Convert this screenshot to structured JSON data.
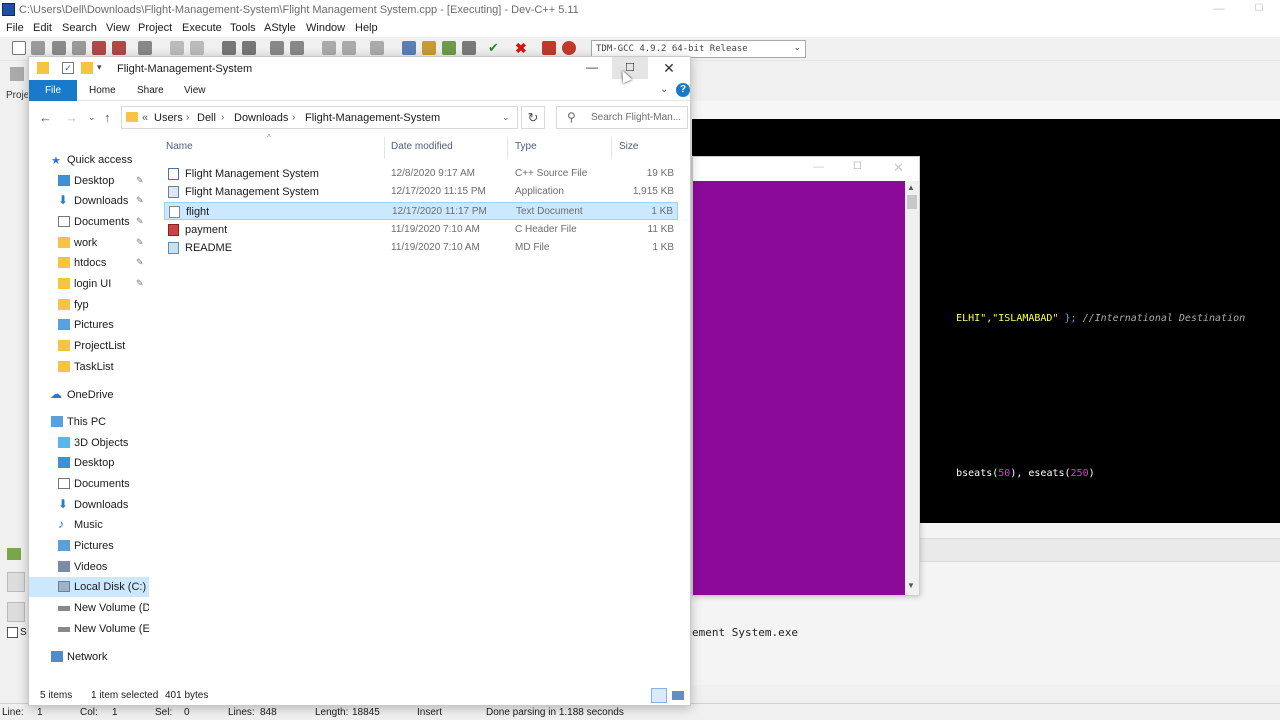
{
  "devcpp": {
    "title": "C:\\Users\\Dell\\Downloads\\Flight-Management-System\\Flight Management System.cpp - [Executing] - Dev-C++ 5.11",
    "menu": [
      "File",
      "Edit",
      "Search",
      "View",
      "Project",
      "Execute",
      "Tools",
      "AStyle",
      "Window",
      "Help"
    ],
    "compiler": "TDM-GCC 4.9.2 64-bit Release",
    "project_label": "Proje",
    "code_line1_string": "ELHI\",\"ISLAMABAD\"",
    "code_line1_brace": " };",
    "code_line1_comment": "//International Destination",
    "code_line2_a": "bseats(",
    "code_line2_n1": "50",
    "code_line2_b": "), eseats(",
    "code_line2_n2": "250",
    "code_line2_c": ")",
    "output_line": "ement System.exe",
    "status": {
      "line_label": "Line:",
      "line_value": "1",
      "col_label": "Col:",
      "col_value": "1",
      "sel_label": "Sel:",
      "sel_value": "0",
      "lines_label": "Lines:",
      "lines_value": "848",
      "length_label": "Length:",
      "length_value": "18845",
      "mode": "Insert",
      "parse": "Done parsing in 1.188 seconds"
    }
  },
  "explorer": {
    "title": "Flight-Management-System",
    "ribbon_tabs": [
      "File",
      "Home",
      "Share",
      "View"
    ],
    "breadcrumb": [
      "Users",
      "Dell",
      "Downloads",
      "Flight-Management-System"
    ],
    "breadcrumb_overflow": "«",
    "search_placeholder": "Search Flight-Man...",
    "nav": {
      "quick_access": "Quick access",
      "quick_items": [
        "Desktop",
        "Downloads",
        "Documents",
        "work",
        "htdocs",
        "login UI",
        "fyp",
        "Pictures",
        "ProjectList",
        "TaskList"
      ],
      "onedrive": "OneDrive",
      "this_pc": "This PC",
      "pc_items": [
        "3D Objects",
        "Desktop",
        "Documents",
        "Downloads",
        "Music",
        "Pictures",
        "Videos",
        "Local Disk (C:)",
        "New Volume (D:",
        "New Volume (E:)"
      ],
      "network": "Network"
    },
    "columns": [
      "Name",
      "Date modified",
      "Type",
      "Size"
    ],
    "files": [
      {
        "name": "Flight Management System",
        "date": "12/8/2020 9:17 AM",
        "type": "C++ Source File",
        "size": "19 KB",
        "icon": "cpp-file-icon"
      },
      {
        "name": "Flight Management System",
        "date": "12/17/2020 11:15 PM",
        "type": "Application",
        "size": "1,915 KB",
        "icon": "exe-file-icon"
      },
      {
        "name": "flight",
        "date": "12/17/2020 11:17 PM",
        "type": "Text Document",
        "size": "1 KB",
        "icon": "text-file-icon"
      },
      {
        "name": "payment",
        "date": "11/19/2020 7:10 AM",
        "type": "C Header File",
        "size": "11 KB",
        "icon": "header-file-icon"
      },
      {
        "name": "README",
        "date": "11/19/2020 7:10 AM",
        "type": "MD File",
        "size": "1 KB",
        "icon": "md-file-icon"
      }
    ],
    "status": {
      "count": "5 items",
      "selected": "1 item selected",
      "bytes": "401 bytes"
    }
  }
}
